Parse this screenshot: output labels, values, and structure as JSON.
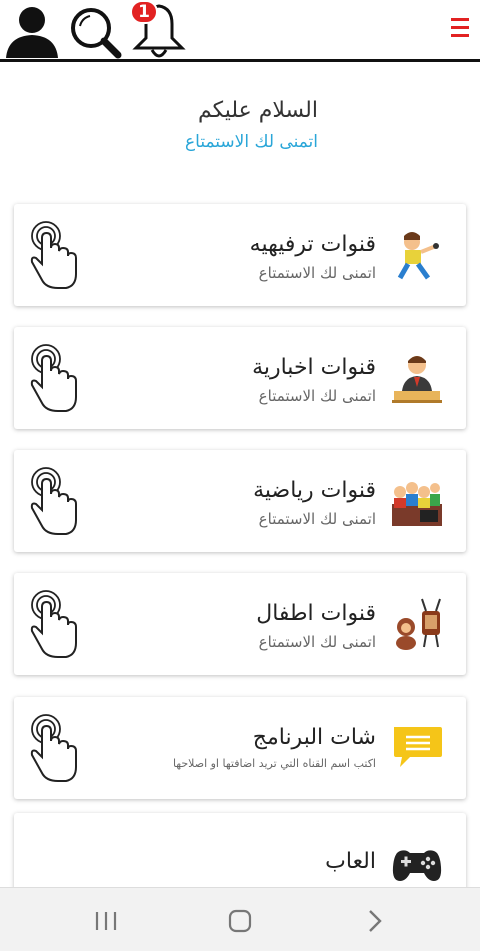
{
  "header": {
    "notification_count": "1",
    "icons": [
      "user-icon",
      "search-icon",
      "bell-icon",
      "menu-icon"
    ],
    "accent_color": "#e22222"
  },
  "greeting": {
    "title": "السلام عليكم",
    "subtitle": "اتمنى لك الاستمتاع",
    "subtitle_color": "#2aa6d8"
  },
  "cards": [
    {
      "title": "قنوات ترفيهيه",
      "subtitle": "اتمنى لك الاستمتاع",
      "icon": "entertainment-icon"
    },
    {
      "title": "قنوات اخبارية",
      "subtitle": "اتمنى لك الاستمتاع",
      "icon": "news-icon"
    },
    {
      "title": "قنوات رياضية",
      "subtitle": "اتمنى لك الاستمتاع",
      "icon": "sports-icon"
    },
    {
      "title": "قنوات اطفال",
      "subtitle": "اتمنى لك الاستمتاع",
      "icon": "kids-icon"
    },
    {
      "title": "شات البرنامج",
      "subtitle": "اكتب اسم القناه التي تريد اضافتها او اصلاحها",
      "icon": "chat-icon"
    },
    {
      "title": "العاب",
      "subtitle": "",
      "icon": "gamepad-icon"
    }
  ],
  "system_nav": {
    "icons": [
      "recents-icon",
      "home-icon",
      "back-icon"
    ]
  }
}
